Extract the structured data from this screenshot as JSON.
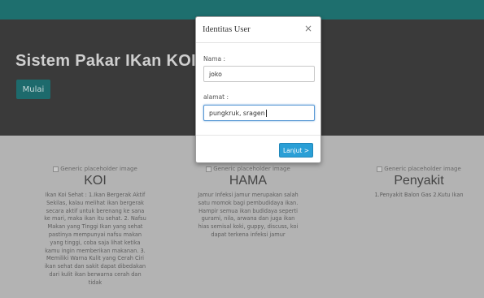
{
  "jumbotron": {
    "title": "Sistem Pakar IKan KOI.",
    "button_label": "Mulai"
  },
  "columns": [
    {
      "image_alt": "Generic placeholder image",
      "heading": "KOI",
      "text": "Ikan Koi Sehat : 1.Ikan Bergerak Aktif Sekilas, kalau melihat ikan bergerak secara aktif untuk berenang ke sana ke mari, maka ikan itu sehat. 2. Nafsu Makan yang Tinggi Ikan yang sehat pastinya mempunyai nafsu makan yang tinggi, coba saja lihat ketika kamu ingin memberikan makanan. 3. Memiliki Warna Kulit yang Cerah Ciri ikan sehat dan sakit dapat dibedakan dari kulit ikan berwarna cerah dan tidak"
    },
    {
      "image_alt": "Generic placeholder image",
      "heading": "HAMA",
      "text": "Jamur Infeksi jamur merupakan salah satu momok bagi pembudidaya ikan. Hampir semua ikan budidaya seperti gurami, nila, arwana dan juga ikan hias semisal koki, guppy, discuss, koi dapat terkena infeksi jamur"
    },
    {
      "image_alt": "Generic placeholder image",
      "heading": "Penyakit",
      "text": "1.Penyakit Balon Gas 2.Kutu Ikan"
    }
  ],
  "modal": {
    "title": "Identitas User",
    "close_symbol": "×",
    "nama_label": "Nama :",
    "nama_value": "joko",
    "alamat_label": "alamat :",
    "alamat_value": "pungkruk, sragen",
    "submit_label": "Lanjut >"
  },
  "colors": {
    "navbar": "#1e6f6e",
    "jumbotron": "#3a3a3a",
    "primary_button": "#2a9fd6"
  }
}
